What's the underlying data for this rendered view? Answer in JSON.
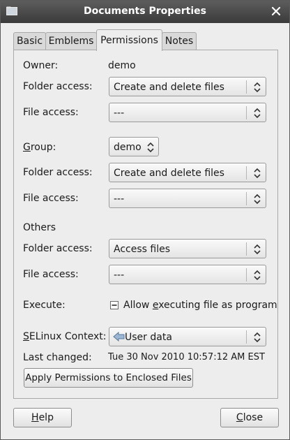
{
  "window": {
    "title": "Documents Properties"
  },
  "tabs": [
    "Basic",
    "Emblems",
    "Permissions",
    "Notes"
  ],
  "owner": {
    "label": "Owner:",
    "value": "demo",
    "folder_label": "Folder access:",
    "folder_value": "Create and delete files",
    "file_label": "File access:",
    "file_value": "---"
  },
  "group": {
    "label_pre": "",
    "label_u": "G",
    "label_post": "roup:",
    "value": "demo",
    "folder_label": "Folder access:",
    "folder_value": "Create and delete files",
    "file_label": "File access:",
    "file_value": "---"
  },
  "others": {
    "heading": "Others",
    "folder_label": "Folder access:",
    "folder_value": "Access files",
    "file_label": "File access:",
    "file_value": "---"
  },
  "execute": {
    "label": "Execute:",
    "check_pre": "Allow ",
    "check_u": "e",
    "check_post": "xecuting file as program",
    "checked": false
  },
  "selinux": {
    "label_u": "S",
    "label_post": "ELinux Context:",
    "value": "User data"
  },
  "last_changed": {
    "label": "Last changed:",
    "value": "Tue 30 Nov 2010 10:57:12 AM EST"
  },
  "apply_button": "Apply Permissions to Enclosed Files",
  "help_button": {
    "u": "H",
    "post": "elp"
  },
  "close_button": {
    "u": "C",
    "post": "lose"
  },
  "icons": {
    "window": "folder-icon",
    "close": "close-icon",
    "selinux": "user-data-icon"
  }
}
